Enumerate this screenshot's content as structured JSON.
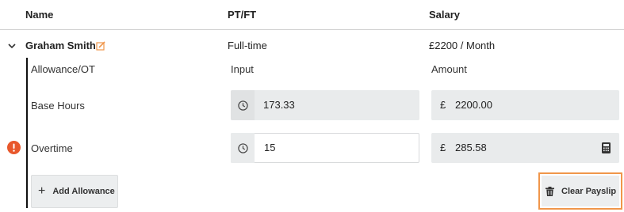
{
  "headers": {
    "name": "Name",
    "ptft": "PT/FT",
    "salary": "Salary"
  },
  "employee": {
    "name": "Graham Smith",
    "type": "Full-time",
    "salary": "£2200 / Month"
  },
  "subheaders": {
    "allowance": "Allowance/OT",
    "input": "Input",
    "amount": "Amount"
  },
  "rows": [
    {
      "label": "Base Hours",
      "input": "173.33",
      "currency": "£",
      "amount": "2200.00"
    },
    {
      "label": "Overtime",
      "input": "15",
      "currency": "£",
      "amount": "285.58"
    }
  ],
  "buttons": {
    "add_allowance": "Add Allowance",
    "clear_payslip": "Clear Payslip"
  },
  "colors": {
    "warning": "#e8582c",
    "edit": "#f0964a",
    "highlight": "#f0964a"
  },
  "icons": {
    "expand": "chevron-down-icon",
    "edit": "edit-icon",
    "clock": "clock-icon",
    "warning": "warning-icon",
    "calculator": "calculator-icon",
    "plus": "plus-icon",
    "trash": "trash-icon"
  }
}
